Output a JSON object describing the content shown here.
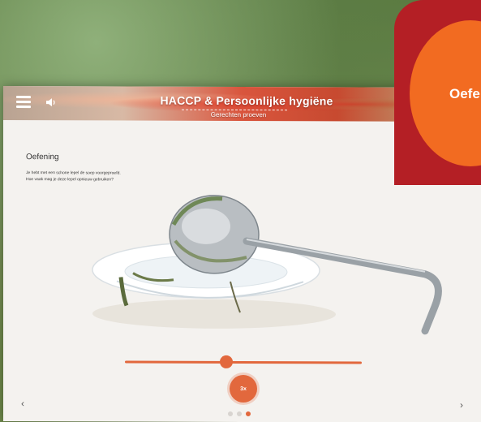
{
  "header": {
    "title": "HACCP & Persoonlijke hygiëne",
    "subtitle": "Gerechten proeven"
  },
  "content": {
    "section_title": "Oefening",
    "question_line1": "Je hebt met een schone lepel de soep voorgeproefd.",
    "question_line2": "Hoe vaak mag je deze lepel opnieuw gebruiken?"
  },
  "slider": {
    "value": 3,
    "fill_fraction": 0.43,
    "value_label": "3x"
  },
  "pagination": {
    "pages": 3,
    "current_index": 2
  },
  "corner_badge": {
    "label": "Oefe"
  },
  "colors": {
    "accent": "#e2683d",
    "corner_red": "#b41f25",
    "corner_orange": "#f26b21"
  },
  "icons": {
    "menu": "menu-icon",
    "sound": "speaker-icon",
    "prev": "chevron-left-icon",
    "next": "chevron-right-icon"
  }
}
